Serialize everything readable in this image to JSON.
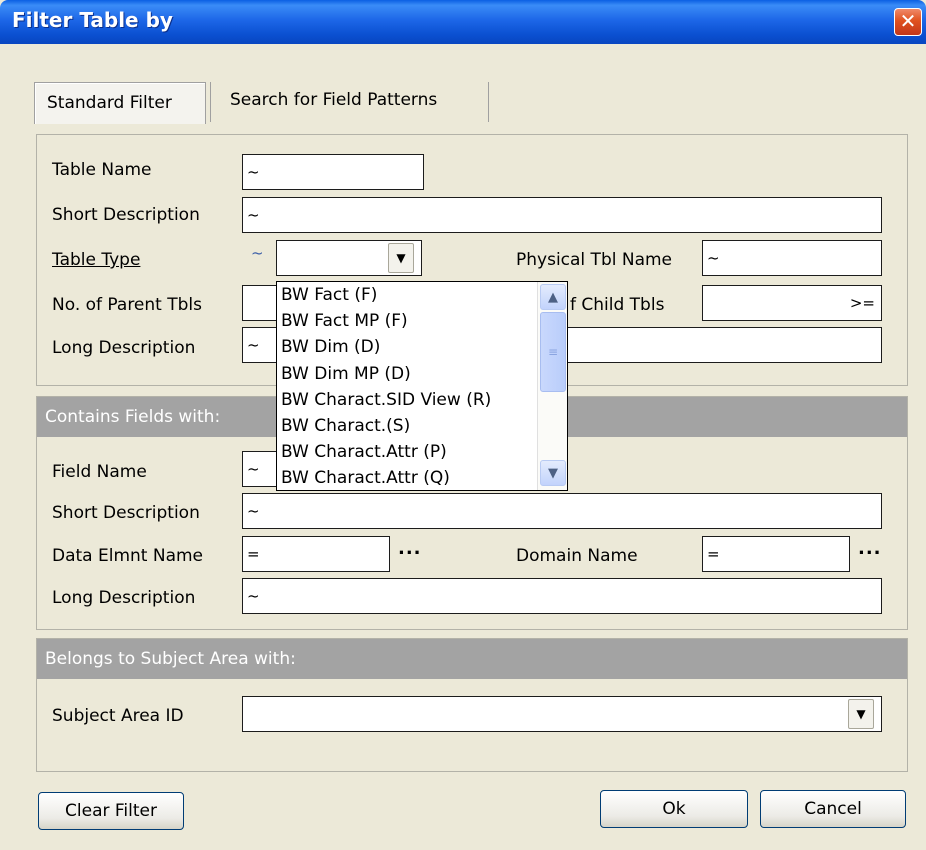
{
  "window": {
    "title": "Filter Table by",
    "close_glyph": "✕"
  },
  "tabs": [
    {
      "label": "Standard Filter"
    },
    {
      "label": "Search for Field Patterns"
    }
  ],
  "table_section": {
    "table_name": {
      "label": "Table Name",
      "value": "~"
    },
    "short_description": {
      "label": "Short Description",
      "value": "~"
    },
    "table_type": {
      "label": "Table Type",
      "operator": "~",
      "value": ""
    },
    "physical_tbl_name": {
      "label": "Physical Tbl Name",
      "value": "~"
    },
    "parent_tbls": {
      "label": "No. of Parent Tbls",
      "value": ""
    },
    "child_tbls": {
      "label": "f Child Tbls",
      "value": ">="
    },
    "long_description": {
      "label": "Long Description",
      "value": "~"
    }
  },
  "table_type_options": [
    "BW Fact (F)",
    "BW Fact MP (F)",
    "BW Dim (D)",
    "BW Dim MP (D)",
    "BW Charact.SID View (R)",
    "BW Charact.(S)",
    "BW Charact.Attr (P)",
    "BW Charact.Attr (Q)"
  ],
  "fields_section": {
    "header": "Contains Fields with:",
    "field_name": {
      "label": "Field Name",
      "value": "~"
    },
    "short_description": {
      "label": "Short Description",
      "value": "~"
    },
    "data_elmnt_name": {
      "label": "Data Elmnt Name",
      "value": "="
    },
    "domain_name": {
      "label": "Domain Name",
      "value": "="
    },
    "long_description": {
      "label": "Long Description",
      "value": "~"
    },
    "ellipsis": "..."
  },
  "subject_section": {
    "header": "Belongs to Subject Area with:",
    "subject_area_id": {
      "label": "Subject Area ID",
      "value": ""
    }
  },
  "buttons": {
    "clear": "Clear Filter",
    "ok": "Ok",
    "cancel": "Cancel"
  },
  "colors": {
    "titlebar": "#0a4fd0",
    "section_header": "#a3a3a3",
    "dialog_bg": "#ece9d8"
  }
}
